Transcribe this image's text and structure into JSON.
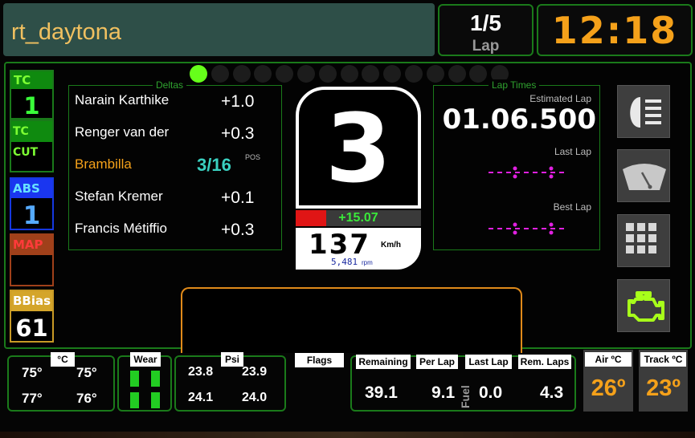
{
  "header": {
    "track_name": "rt_daytona",
    "lap_value": "1/5",
    "lap_label": "Lap",
    "clock": "12:18"
  },
  "left_panel": {
    "tc_label": "TC",
    "tc_value": "1",
    "tc_cut_label": "TC CUT",
    "tc_cut_value": "",
    "abs_label": "ABS",
    "abs_value": "1",
    "map_label": "MAP",
    "map_value": "",
    "bbias_label": "BBias",
    "bbias_value": "61"
  },
  "deltas": {
    "title": "Deltas",
    "rows": [
      {
        "name": "Narain Karthike",
        "value": "+1.0"
      },
      {
        "name": "Renger van der",
        "value": "+0.3"
      },
      {
        "name": "Brambilla",
        "value": "3/16",
        "suffix": "POS"
      },
      {
        "name": "Stefan Kremer",
        "value": "+0.1"
      },
      {
        "name": "Francis Métiffio",
        "value": "+0.3"
      }
    ]
  },
  "gear": {
    "value": "3",
    "delta": "+15.07",
    "speed": "137",
    "speed_unit": "Km/h",
    "rpm": "5,481",
    "rpm_unit": "rpm"
  },
  "lap_times": {
    "title": "Lap Times",
    "estimated_label": "Estimated Lap",
    "estimated_value": "01.06.500",
    "last_label": "Last Lap",
    "best_label": "Best Lap"
  },
  "shift_lights": {
    "count": 15,
    "lit": 1,
    "lit_color": "#66ff1a",
    "off_color": "#1c1c1c"
  },
  "icons": [
    "headlight-icon",
    "wiper-icon",
    "grid-icon",
    "engine-warning-icon"
  ],
  "bottom": {
    "temps": {
      "unit": "°C",
      "fl": "75°",
      "fr": "75°",
      "rl": "77°",
      "rr": "76°"
    },
    "wear": {
      "label": "Wear"
    },
    "psi": {
      "unit": "Psi",
      "fl": "23.8",
      "fr": "23.9",
      "rl": "24.1",
      "rr": "24.0"
    },
    "flags": {
      "label": "Flags"
    },
    "fuel": {
      "remaining_label": "Remaining",
      "remaining": "39.1",
      "perlap_label": "Per Lap",
      "perlap": "9.1",
      "fuel_vertical": "Fuel",
      "lastlap_label": "Last Lap",
      "lastlap": "0.0",
      "remlaps_label": "Rem. Laps",
      "remlaps": "4.3"
    },
    "air": {
      "label": "Air ºC",
      "value": "26º"
    },
    "track": {
      "label": "Track ºC",
      "value": "23º"
    }
  },
  "colors": {
    "accent_orange": "#f5a11a",
    "panel_green": "#1a7a1a",
    "delta_red": "#e01515",
    "delta_green": "#3ae83a",
    "magenta": "#e020e0"
  }
}
